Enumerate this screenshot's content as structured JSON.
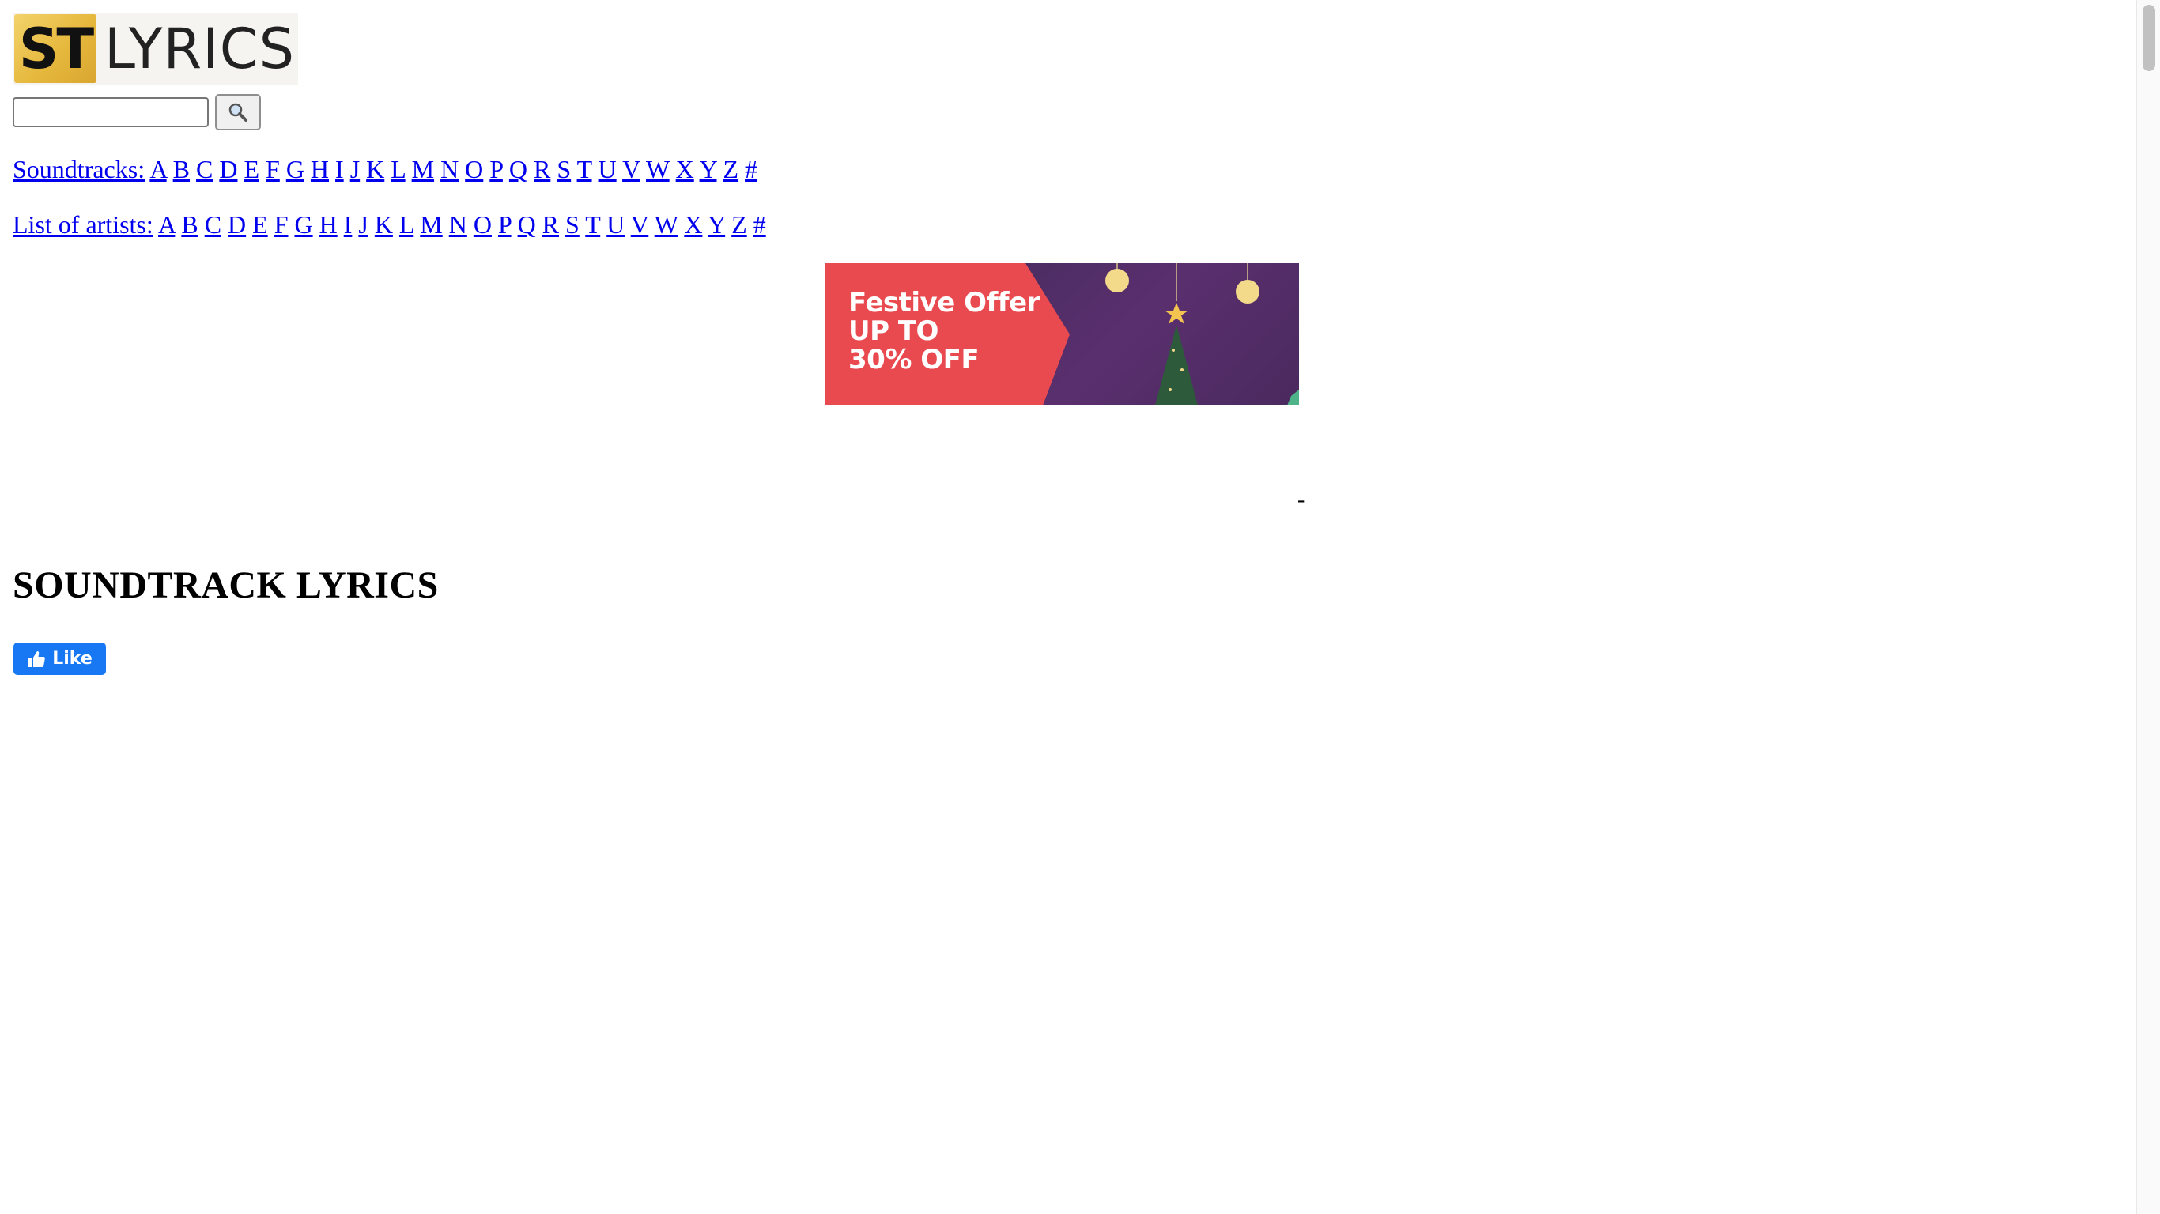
{
  "logo": {
    "st": "ST",
    "lyrics": "LYRICS"
  },
  "search": {
    "value": "",
    "button_icon": "magnifier-icon"
  },
  "soundtracks": {
    "label": "Soundtracks:",
    "letters": [
      "A",
      "B",
      "C",
      "D",
      "E",
      "F",
      "G",
      "H",
      "I",
      "J",
      "K",
      "L",
      "M",
      "N",
      "O",
      "P",
      "Q",
      "R",
      "S",
      "T",
      "U",
      "V",
      "W",
      "X",
      "Y",
      "Z",
      "#"
    ]
  },
  "artists": {
    "label": "List of artists:",
    "letters": [
      "A",
      "B",
      "C",
      "D",
      "E",
      "F",
      "G",
      "H",
      "I",
      "J",
      "K",
      "L",
      "M",
      "N",
      "O",
      "P",
      "Q",
      "R",
      "S",
      "T",
      "U",
      "V",
      "W",
      "X",
      "Y",
      "Z",
      "#"
    ]
  },
  "banner": {
    "line1": "Festive Offer",
    "line2": "UP TO",
    "line3": "30% OFF"
  },
  "dash": "-",
  "heading": "SOUNDTRACK LYRICS",
  "fb_like": {
    "label": "Like",
    "icon": "thumbs-up-icon"
  },
  "colors": {
    "link": "#0000ee",
    "banner_red": "#e94a4f",
    "banner_purple": "#5a2f6e",
    "facebook_blue": "#1877f2",
    "logo_gold": "#e6b83d"
  }
}
